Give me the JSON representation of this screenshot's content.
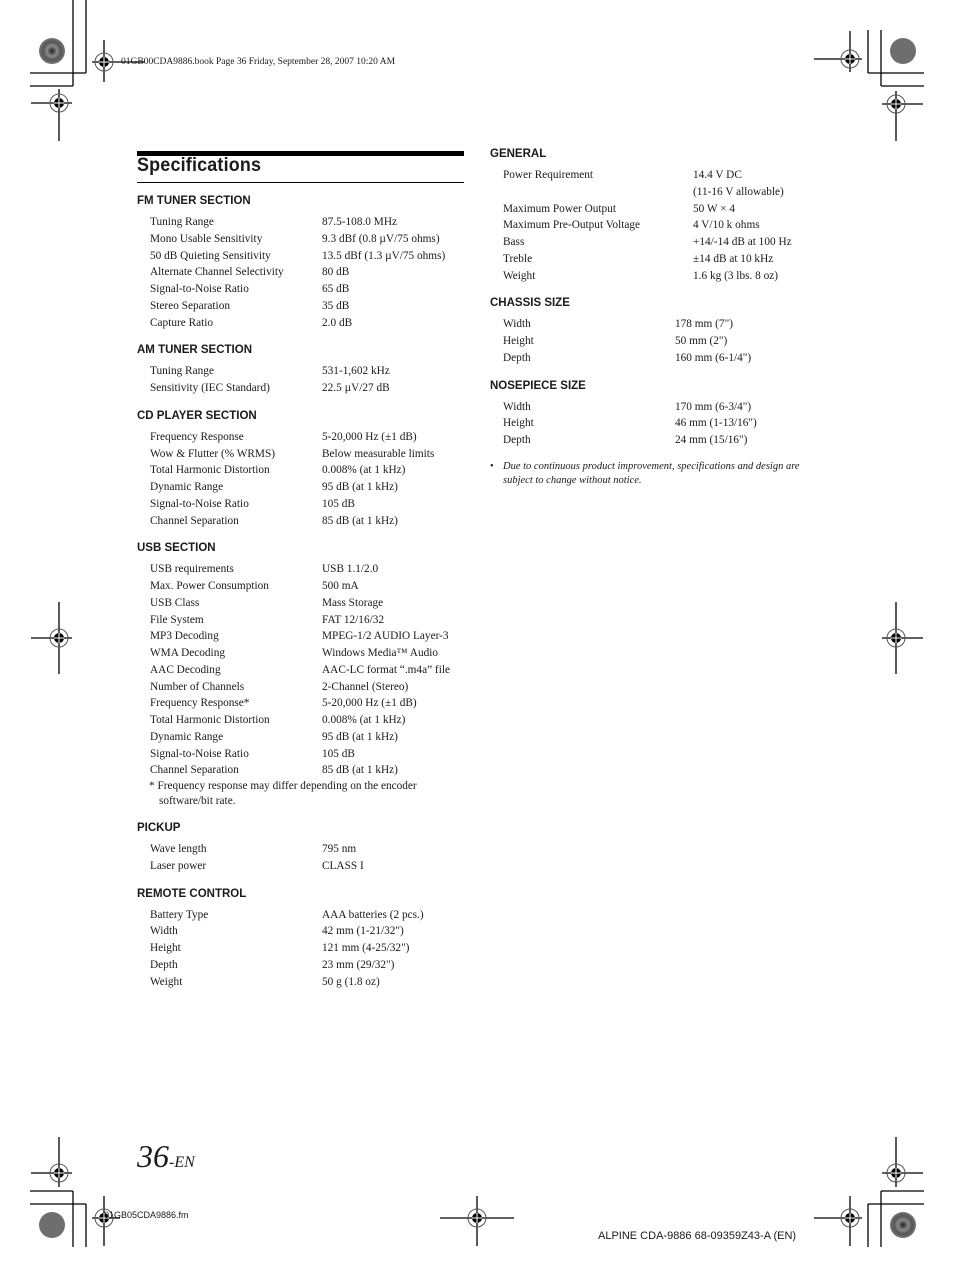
{
  "print_marks": {
    "book_header": "01GB00CDA9886.book  Page 36  Friday, September 28, 2007  10:20 AM",
    "fm_footer": "01GB05CDA9886.fm",
    "model_footer": "ALPINE CDA-9886 68-09359Z43-A (EN)"
  },
  "page": {
    "title": "Specifications",
    "number": "36",
    "number_suffix": "-EN"
  },
  "left_column": {
    "sections": [
      {
        "heading": "FM TUNER SECTION",
        "rows": [
          {
            "label": "Tuning Range",
            "value": "87.5-108.0 MHz"
          },
          {
            "label": "Mono Usable Sensitivity",
            "value": "9.3 dBf (0.8 µV/75 ohms)"
          },
          {
            "label": "50 dB Quieting Sensitivity",
            "value": "13.5 dBf (1.3 µV/75 ohms)"
          },
          {
            "label": "Alternate Channel Selectivity",
            "value": "80 dB"
          },
          {
            "label": "Signal-to-Noise Ratio",
            "value": "65 dB"
          },
          {
            "label": "Stereo Separation",
            "value": "35 dB"
          },
          {
            "label": "Capture Ratio",
            "value": "2.0 dB"
          }
        ]
      },
      {
        "heading": "AM TUNER SECTION",
        "rows": [
          {
            "label": "Tuning Range",
            "value": "531-1,602 kHz"
          },
          {
            "label": "Sensitivity (IEC Standard)",
            "value": "22.5 µV/27 dB"
          }
        ]
      },
      {
        "heading": "CD PLAYER SECTION",
        "rows": [
          {
            "label": "Frequency Response",
            "value": "5-20,000 Hz (±1 dB)"
          },
          {
            "label": "Wow & Flutter (% WRMS)",
            "value": "Below measurable limits"
          },
          {
            "label": "Total Harmonic Distortion",
            "value": "0.008% (at 1 kHz)"
          },
          {
            "label": "Dynamic Range",
            "value": "95 dB (at 1 kHz)"
          },
          {
            "label": "Signal-to-Noise Ratio",
            "value": "105 dB"
          },
          {
            "label": "Channel Separation",
            "value": "85 dB (at 1 kHz)"
          }
        ]
      },
      {
        "heading": "USB SECTION",
        "rows": [
          {
            "label": "USB requirements",
            "value": "USB 1.1/2.0"
          },
          {
            "label": "Max. Power Consumption",
            "value": "500 mA"
          },
          {
            "label": "USB Class",
            "value": "Mass Storage"
          },
          {
            "label": "File System",
            "value": "FAT 12/16/32"
          },
          {
            "label": "MP3 Decoding",
            "value": "MPEG-1/2 AUDIO Layer-3"
          },
          {
            "label": "WMA Decoding",
            "value": "Windows Media™ Audio"
          },
          {
            "label": "AAC Decoding",
            "value": "AAC-LC format “.m4a” file"
          },
          {
            "label": "Number of Channels",
            "value": "2-Channel (Stereo)"
          },
          {
            "label": "Frequency Response*",
            "value": "5-20,000 Hz (±1 dB)"
          },
          {
            "label": "Total Harmonic Distortion",
            "value": "0.008% (at 1 kHz)"
          },
          {
            "label": "Dynamic Range",
            "value": "95 dB (at 1 kHz)"
          },
          {
            "label": "Signal-to-Noise Ratio",
            "value": "105 dB"
          },
          {
            "label": "Channel Separation",
            "value": "85 dB (at 1 kHz)"
          }
        ],
        "footnote": "* Frequency response may differ depending on the encoder software/bit rate."
      },
      {
        "heading": "PICKUP",
        "rows": [
          {
            "label": "Wave length",
            "value": "795 nm"
          },
          {
            "label": "Laser power",
            "value": "CLASS I"
          }
        ]
      },
      {
        "heading": "REMOTE CONTROL",
        "rows": [
          {
            "label": "Battery Type",
            "value": "AAA batteries (2 pcs.)"
          },
          {
            "label": "Width",
            "value": "42 mm (1-21/32\")"
          },
          {
            "label": "Height",
            "value": "121 mm (4-25/32\")"
          },
          {
            "label": "Depth",
            "value": "23 mm (29/32\")"
          },
          {
            "label": "Weight",
            "value": "50 g (1.8 oz)"
          }
        ]
      }
    ]
  },
  "right_column": {
    "sections": [
      {
        "heading": "GENERAL",
        "rows": [
          {
            "label": "Power Requirement",
            "value": "14.4 V DC"
          },
          {
            "label": "",
            "value": "(11-16 V allowable)"
          },
          {
            "label": "Maximum Power Output",
            "value": "50 W × 4"
          },
          {
            "label": "Maximum Pre-Output Voltage",
            "value": "4 V/10 k ohms"
          },
          {
            "label": "Bass",
            "value": "+14/-14 dB at 100 Hz"
          },
          {
            "label": "Treble",
            "value": "±14 dB at 10 kHz"
          },
          {
            "label": "Weight",
            "value": "1.6 kg (3 lbs. 8 oz)"
          }
        ]
      },
      {
        "heading": "CHASSIS SIZE",
        "rows": [
          {
            "label": "Width",
            "value": "178 mm (7\")"
          },
          {
            "label": "Height",
            "value": "50 mm (2\")"
          },
          {
            "label": "Depth",
            "value": "160 mm (6-1/4\")"
          }
        ]
      },
      {
        "heading": "NOSEPIECE SIZE",
        "rows": [
          {
            "label": "Width",
            "value": "170 mm (6-3/4\")"
          },
          {
            "label": "Height",
            "value": "46 mm (1-13/16\")"
          },
          {
            "label": "Depth",
            "value": "24 mm (15/16\")"
          }
        ]
      }
    ],
    "note": {
      "bullet": "•",
      "text": "Due to continuous product improvement, specifications and design are subject to change without notice."
    }
  }
}
